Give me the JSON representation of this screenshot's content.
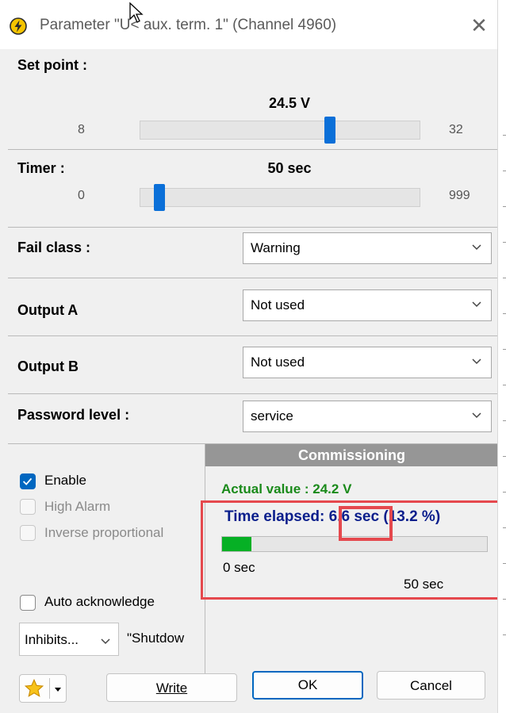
{
  "window": {
    "title": "Parameter \"U< aux. term. 1\" (Channel 4960)",
    "close_glyph": "✕",
    "title_icon": "lightning-bolt-icon"
  },
  "setpoint": {
    "label": "Set point :",
    "value_text": "24.5 V",
    "min": "8",
    "max": "32",
    "value": 24.5
  },
  "timer": {
    "label": "Timer :",
    "value_text": "50 sec",
    "min": "0",
    "max": "999",
    "value": 50
  },
  "fail_class": {
    "label": "Fail class :",
    "value": "Warning"
  },
  "output_a": {
    "label": "Output A",
    "value": "Not used"
  },
  "output_b": {
    "label": "Output B",
    "value": "Not used"
  },
  "password": {
    "label": "Password level :",
    "value": "service"
  },
  "options": {
    "enable": {
      "label": "Enable",
      "checked": true
    },
    "high_alarm": {
      "label": "High Alarm",
      "checked": false,
      "disabled": true
    },
    "inverse": {
      "label": "Inverse proportional",
      "checked": false,
      "disabled": true
    },
    "auto_ack": {
      "label": "Auto acknowledge",
      "checked": false
    }
  },
  "inhibits": {
    "label": "Inhibits...",
    "shutdown_text": "\"Shutdow"
  },
  "commissioning": {
    "header": "Commissioning",
    "actual_value": "Actual value : 24.2 V",
    "elapsed_prefix": "Time elapsed",
    "elapsed_value": ": 6.6",
    "elapsed_suffix": " sec (13.2 %)",
    "progress_fraction": 0.132,
    "progress_min": "0 sec",
    "progress_max": "50 sec"
  },
  "buttons": {
    "write": "Write",
    "ok": "OK",
    "cancel": "Cancel"
  },
  "colors": {
    "accent": "#0067c0",
    "progress": "#06b025",
    "actual_value": "#1a8a1a",
    "elapsed_text": "#0a1e8c",
    "highlight": "#e5484d"
  }
}
